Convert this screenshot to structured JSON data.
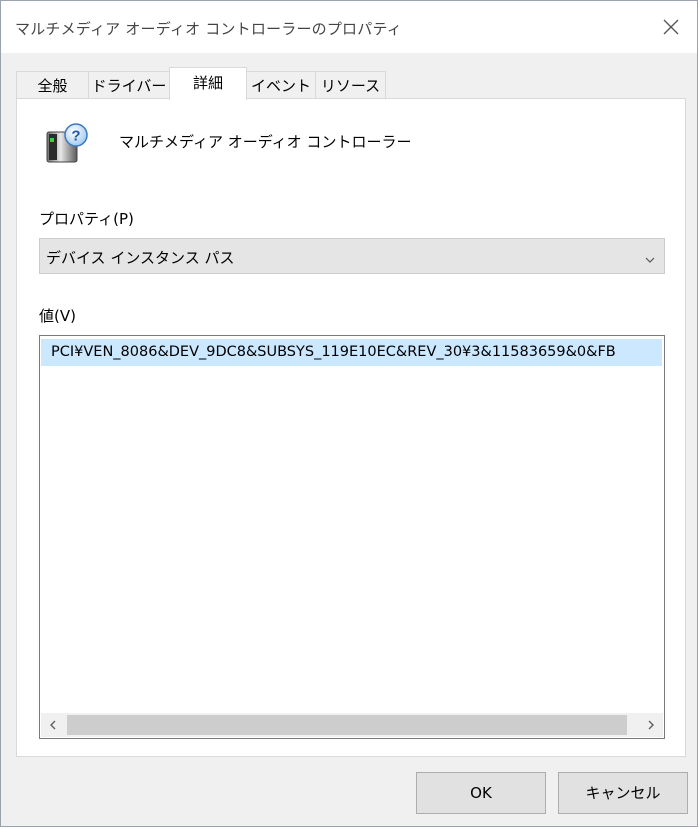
{
  "window": {
    "title": "マルチメディア オーディオ コントローラーのプロパティ",
    "close_icon": "close-icon"
  },
  "tabs": [
    {
      "label": "全般",
      "active": false
    },
    {
      "label": "ドライバー",
      "active": false
    },
    {
      "label": "詳細",
      "active": true
    },
    {
      "label": "イベント",
      "active": false
    },
    {
      "label": "リソース",
      "active": false
    }
  ],
  "device": {
    "name": "マルチメディア オーディオ コントローラー",
    "icon": "unknown-device-icon"
  },
  "property": {
    "label": "プロパティ(P)",
    "selected": "デバイス インスタンス パス"
  },
  "value": {
    "label": "値(V)",
    "items": [
      "PCI¥VEN_8086&DEV_9DC8&SUBSYS_119E10EC&REV_30¥3&11583659&0&FB"
    ]
  },
  "buttons": {
    "ok": "OK",
    "cancel": "キャンセル"
  },
  "colors": {
    "selection": "#cce8ff",
    "dialog_background": "#f0f0f0"
  }
}
